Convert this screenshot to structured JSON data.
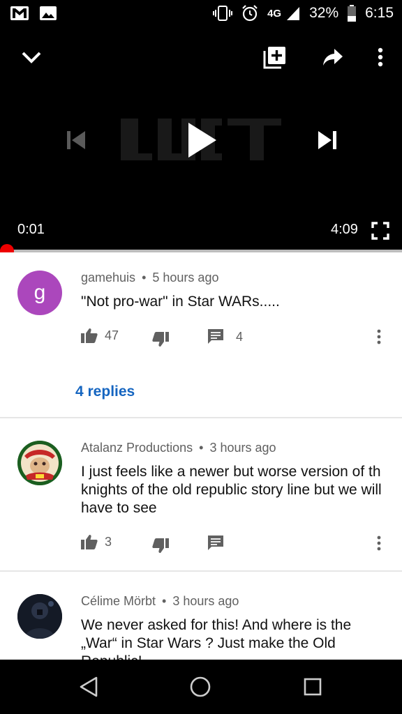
{
  "status_bar": {
    "network": "4G",
    "battery": "32%",
    "time": "6:15"
  },
  "player": {
    "current_time": "0:01",
    "duration": "4:09",
    "progress_fraction": 0.004
  },
  "comments": [
    {
      "author": "gamehuis",
      "age": "5 hours ago",
      "text": "\"Not pro-war\" in Star WARs.....",
      "likes": "47",
      "reply_count": "4",
      "replies_link": "4 replies",
      "avatar_letter": "g",
      "avatar_color": "#ab47bc"
    },
    {
      "author": "Atalanz Productions",
      "age": "3 hours ago",
      "text": "I just feels like a newer but worse version of th knights of the old republic story line but we will have to see",
      "likes": "3"
    },
    {
      "author": "Célime Mörbt",
      "age": "3 hours ago",
      "text": "We never asked for this! And where is the „War“ in Star Wars ? Just make the Old Republic!"
    }
  ],
  "separator": "•",
  "colors": {
    "link": "#1565c0",
    "progress": "#e00000",
    "meta_text": "#606060"
  }
}
